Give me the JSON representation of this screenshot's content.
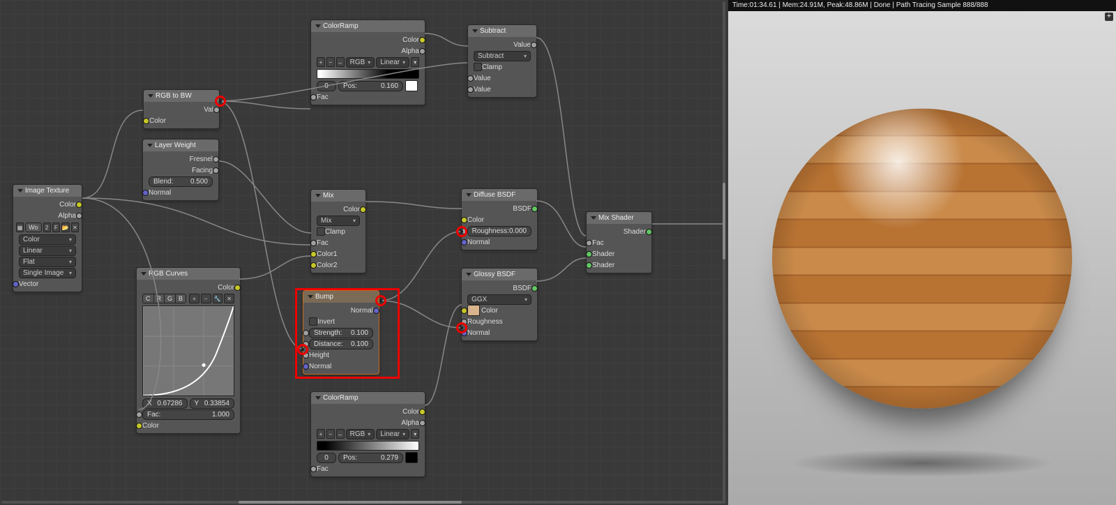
{
  "status": "Time:01:34.61 | Mem:24.91M, Peak:48.86M | Done | Path Tracing Sample 888/888",
  "nodes": {
    "image_texture": {
      "title": "Image Texture",
      "out_color": "Color",
      "out_alpha": "Alpha",
      "tex_name": "Wo",
      "tex_users": "2",
      "tex_fake": "F",
      "interp": "Linear",
      "proj": "Flat",
      "source": "Single Image",
      "in_vector": "Vector",
      "colorspace": "Color"
    },
    "rgb_to_bw": {
      "title": "RGB to BW",
      "out_val": "Val",
      "in_color": "Color"
    },
    "layer_weight": {
      "title": "Layer Weight",
      "out_fresnel": "Fresnel",
      "out_facing": "Facing",
      "blend_lbl": "Blend:",
      "blend_val": "0.500",
      "in_normal": "Normal"
    },
    "rgb_curves": {
      "title": "RGB Curves",
      "out_color": "Color",
      "tabs": [
        "C",
        "R",
        "G",
        "B"
      ],
      "x_lbl": "X",
      "x_val": "0.67286",
      "y_lbl": "Y",
      "y_val": "0.33854",
      "fac_lbl": "Fac:",
      "fac_val": "1.000",
      "in_color": "Color"
    },
    "color_ramp1": {
      "title": "ColorRamp",
      "out_color": "Color",
      "out_alpha": "Alpha",
      "mode": "RGB",
      "interp": "Linear",
      "stop_idx": "0",
      "pos_lbl": "Pos:",
      "pos_val": "0.160",
      "in_fac": "Fac"
    },
    "color_ramp2": {
      "title": "ColorRamp",
      "out_color": "Color",
      "out_alpha": "Alpha",
      "mode": "RGB",
      "interp": "Linear",
      "stop_idx": "0",
      "pos_lbl": "Pos:",
      "pos_val": "0.279",
      "in_fac": "Fac"
    },
    "subtract": {
      "title": "Subtract",
      "out_value": "Value",
      "op": "Subtract",
      "clamp": "Clamp",
      "in_v1": "Value",
      "in_v2": "Value"
    },
    "mix": {
      "title": "Mix",
      "out_color": "Color",
      "mode": "Mix",
      "clamp": "Clamp",
      "in_fac": "Fac",
      "in_c1": "Color1",
      "in_c2": "Color2"
    },
    "bump": {
      "title": "Bump",
      "out_normal": "Normal",
      "invert": "Invert",
      "strength_lbl": "Strength:",
      "strength_val": "0.100",
      "distance_lbl": "Distance:",
      "distance_val": "0.100",
      "in_height": "Height",
      "in_normal": "Normal"
    },
    "diffuse": {
      "title": "Diffuse BSDF",
      "out_bsdf": "BSDF",
      "in_color": "Color",
      "rough_lbl": "Roughness:",
      "rough_val": "0.000",
      "in_normal": "Normal"
    },
    "glossy": {
      "title": "Glossy BSDF",
      "out_bsdf": "BSDF",
      "dist": "GGX",
      "in_color": "Color",
      "in_rough": "Roughness",
      "in_normal": "Normal"
    },
    "mix_shader": {
      "title": "Mix Shader",
      "out_shader": "Shader",
      "in_fac": "Fac",
      "in_s1": "Shader",
      "in_s2": "Shader"
    }
  }
}
